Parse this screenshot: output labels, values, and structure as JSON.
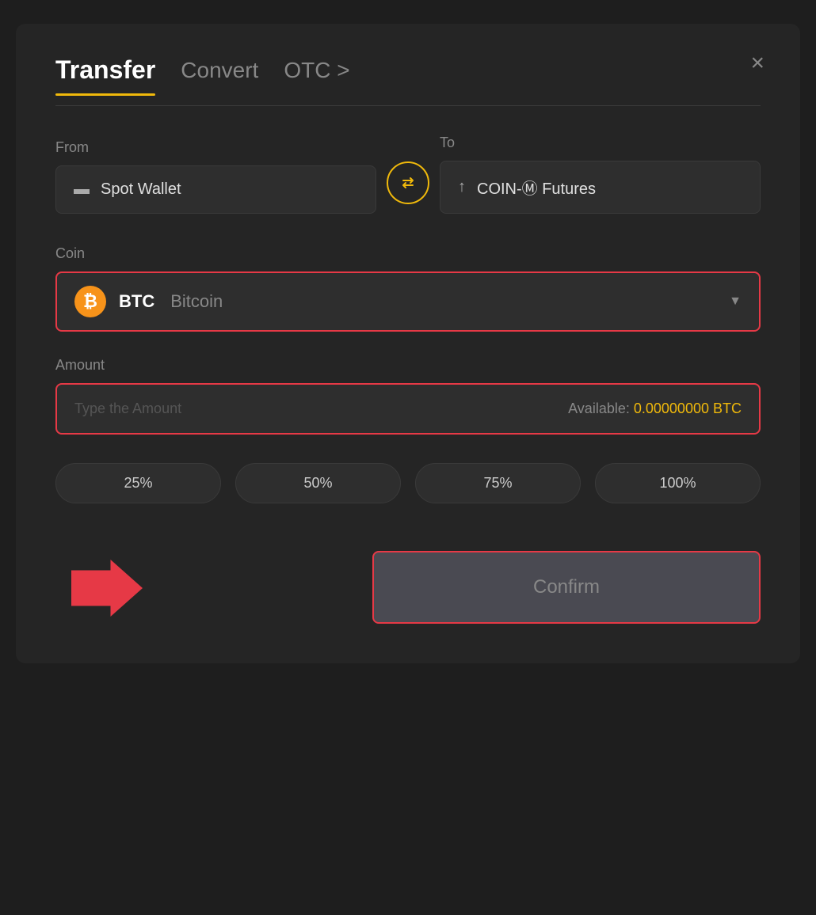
{
  "modal": {
    "title": "Transfer",
    "tabs": [
      {
        "label": "Transfer",
        "active": true
      },
      {
        "label": "Convert",
        "active": false
      },
      {
        "label": "OTC >",
        "active": false
      }
    ],
    "close_label": "×"
  },
  "from": {
    "label": "From",
    "wallet_label": "Spot Wallet"
  },
  "to": {
    "label": "To",
    "wallet_label": "COIN-Ⓜ Futures"
  },
  "swap": {
    "icon": "⇄"
  },
  "coin": {
    "label": "Coin",
    "symbol": "BTC",
    "name": "Bitcoin"
  },
  "amount": {
    "label": "Amount",
    "placeholder": "Type the Amount",
    "available_label": "Available:",
    "available_value": "0.00000000",
    "available_currency": "BTC"
  },
  "percent_buttons": [
    {
      "label": "25%"
    },
    {
      "label": "50%"
    },
    {
      "label": "75%"
    },
    {
      "label": "100%"
    }
  ],
  "confirm": {
    "label": "Confirm"
  }
}
